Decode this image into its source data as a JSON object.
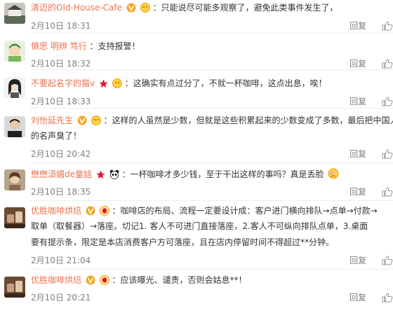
{
  "reply_label": "回复",
  "comments": [
    {
      "name": "清迈的Old-House-Cafe",
      "badge": "V",
      "text": "只能说尽可能多观察了，避免此类事件发生了，",
      "time": "2月10日 18:31"
    },
    {
      "name": "慎思 明辨 笃行",
      "badge": "",
      "text": "支持报警！",
      "time": "2月10日 18:32"
    },
    {
      "name": "不要起名字的猫v",
      "badge": "star",
      "text": "这确实有点过分了，不就一杯咖啡，这点出息，唉！",
      "time": "2月10日 18:33"
    },
    {
      "name": "刘怡延先生",
      "badge": "V",
      "text": "这样的人虽然是少数，但就是这些积累起来的少数变成了多数，最后把中国人",
      "more": [
        "的名声臭了！"
      ],
      "time": "2月10日 20:42"
    },
    {
      "name": "懋懋湏媚de童話",
      "badge": "star",
      "text": "一杯咖啡才多少钱，至于干出这样的事吗？真是丢脸",
      "time": "2月10日 18:35"
    },
    {
      "name": "优胜咖啡烘焙",
      "badge": "V",
      "text": "咖啡店的布局、流程一定要设计成：客户进门横向排队→点单→付款→",
      "more": [
        "取单（取餐器）→落座。切记1. 客人不可进门直接落座，2.客人不可纵向排队点单，3.桌面",
        "要有提示条，限定是本店消费客户方可落座，且在店内停留时间不得超过**分钟。"
      ],
      "time": "2月10日 21:04"
    },
    {
      "name": "优胜咖啡烘焙",
      "badge": "V",
      "text": "应该曝光、谴责，否则会姑息**！",
      "time": "2月10日 20:21"
    }
  ]
}
